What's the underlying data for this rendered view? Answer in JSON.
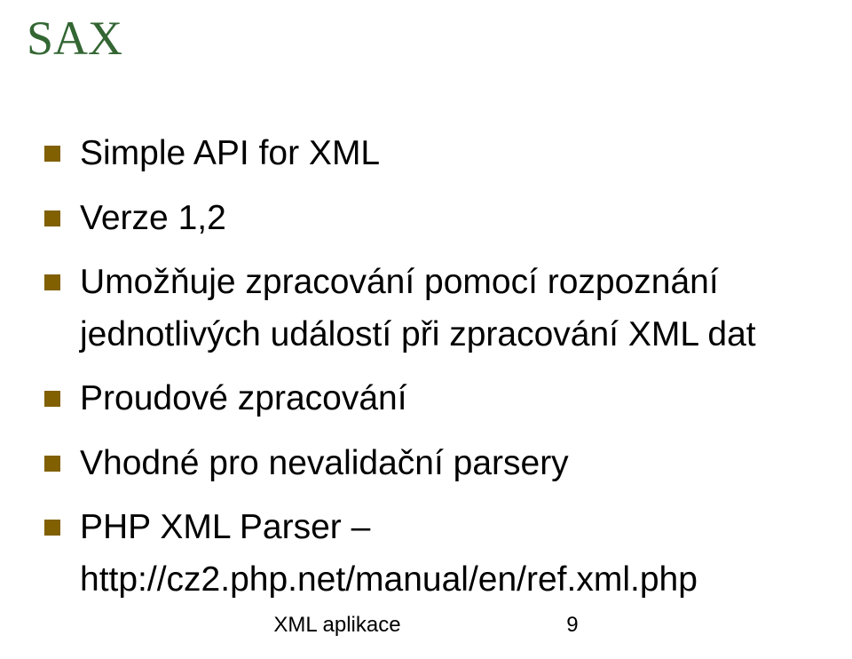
{
  "slide": {
    "title": "SAX",
    "bullets": [
      "Simple API for XML",
      "Verze 1,2",
      "Umožňuje zpracování pomocí rozpoznání jednotlivých událostí při zpracování XML dat",
      "Proudové zpracování",
      "Vhodné pro nevalidační parsery",
      "PHP XML Parser – http://cz2.php.net/manual/en/ref.xml.php"
    ]
  },
  "footer": {
    "text": "XML aplikace",
    "page": "9"
  }
}
